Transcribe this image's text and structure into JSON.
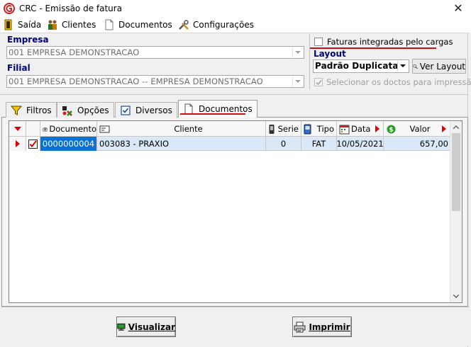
{
  "window": {
    "title": "CRC - Emissão de fatura",
    "close_glyph": "✕"
  },
  "menu": {
    "items": [
      {
        "label": "Saída",
        "icon": "door-exit-icon"
      },
      {
        "label": "Clientes",
        "icon": "people-icon"
      },
      {
        "label": "Documentos",
        "icon": "document-icon"
      },
      {
        "label": "Configurações",
        "icon": "tools-icon"
      }
    ]
  },
  "empresa": {
    "label": "Empresa",
    "value": "001 EMPRESA DEMONSTRACAO"
  },
  "filial": {
    "label": "Filial",
    "value": "001 EMPRESA DEMONSTRACAO -- EMPRESA DEMONSTRACAO"
  },
  "faturas_checkbox": {
    "label": "Faturas integradas pelo cargas",
    "checked": false
  },
  "layout": {
    "label": "Layout",
    "value": "Padrão Duplicata",
    "button_label": "Ver Layout"
  },
  "selecionar_checkbox": {
    "label": "Selecionar os doctos para impressão",
    "checked": true,
    "disabled": true
  },
  "tabs": [
    {
      "label": "Filtros",
      "icon": "funnel-icon",
      "active": false
    },
    {
      "label": "Opções",
      "icon": "options-icon",
      "active": false
    },
    {
      "label": "Diversos",
      "icon": "checkbox-icon",
      "active": false
    },
    {
      "label": "Documentos",
      "icon": "document-icon",
      "active": true
    }
  ],
  "grid": {
    "columns": [
      "Documento",
      "Cliente",
      "Serie",
      "Tipo",
      "Data",
      "Valor"
    ],
    "rows": [
      {
        "checked": true,
        "documento": "0000000004",
        "cliente": "003083 - PRAXIO",
        "serie": "0",
        "tipo": "FAT",
        "data": "10/05/2021",
        "valor": "657,00"
      }
    ]
  },
  "buttons": {
    "visualizar": "Visualizar",
    "imprimir": "Imprimir"
  },
  "colors": {
    "accent_red": "#d01010",
    "selection_blue": "#0a72d4",
    "row_highlight": "#dbe8f7",
    "label_navy": "#00007a"
  }
}
